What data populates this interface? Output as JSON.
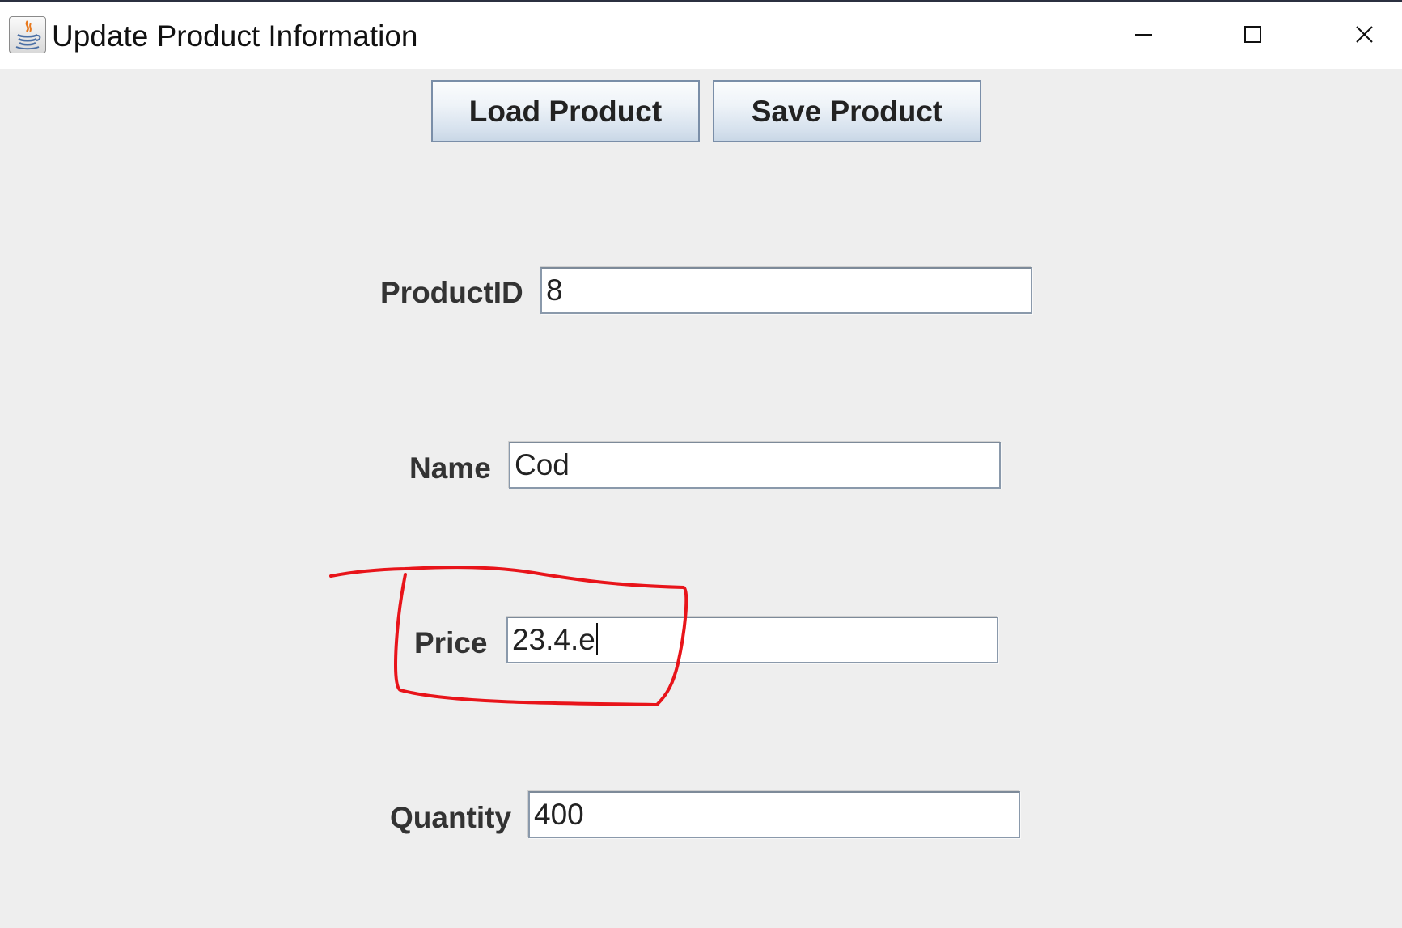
{
  "window": {
    "title": "Update Product Information",
    "icon": "java-coffee-cup-icon",
    "controls": [
      "minimize-icon",
      "maximize-icon",
      "close-icon"
    ]
  },
  "toolbar": {
    "load_label": "Load Product",
    "save_label": "Save Product"
  },
  "form": {
    "product_id": {
      "label": "ProductID",
      "value": "8"
    },
    "name": {
      "label": "Name",
      "value": "Cod"
    },
    "price": {
      "label": "Price",
      "value": "23.4.e"
    },
    "quantity": {
      "label": "Quantity",
      "value": "400"
    }
  },
  "annotation": {
    "color": "#e8141a"
  },
  "colors": {
    "background": "#eeeeee",
    "button_border": "#7a8ea8",
    "input_border": "#8a99ab"
  }
}
